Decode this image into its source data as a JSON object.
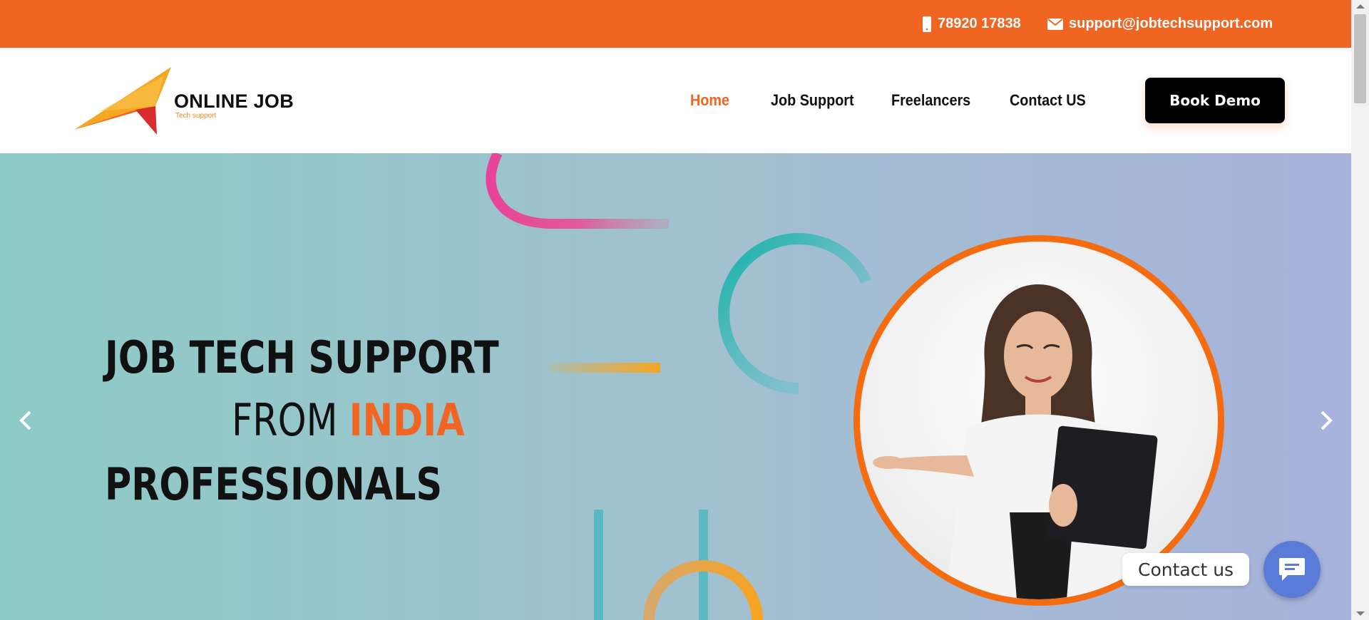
{
  "topbar": {
    "phone": "78920 17838",
    "email": "support@jobtechsupport.com",
    "phone_icon": "mobile-phone-icon",
    "email_icon": "envelope-icon",
    "background": "#f16523"
  },
  "logo": {
    "title": "ONLINE JOB",
    "subtitle": "Tech support"
  },
  "nav": {
    "items": [
      "Home",
      "Job Support",
      "Freelancers",
      "Contact US"
    ],
    "active": "Home",
    "active_color": "#f16523"
  },
  "cta": {
    "label": "Book Demo"
  },
  "hero": {
    "line1": "JOB TECH SUPPORT",
    "line2_prefix": "FROM",
    "line2_highlight": "INDIA",
    "line3": "PROFESSIONALS",
    "prev_icon": "chevron-left-icon",
    "next_icon": "chevron-right-icon"
  },
  "chat": {
    "label": "Contact us",
    "icon": "chat-bubble-icon",
    "color": "#5a7bd8"
  }
}
